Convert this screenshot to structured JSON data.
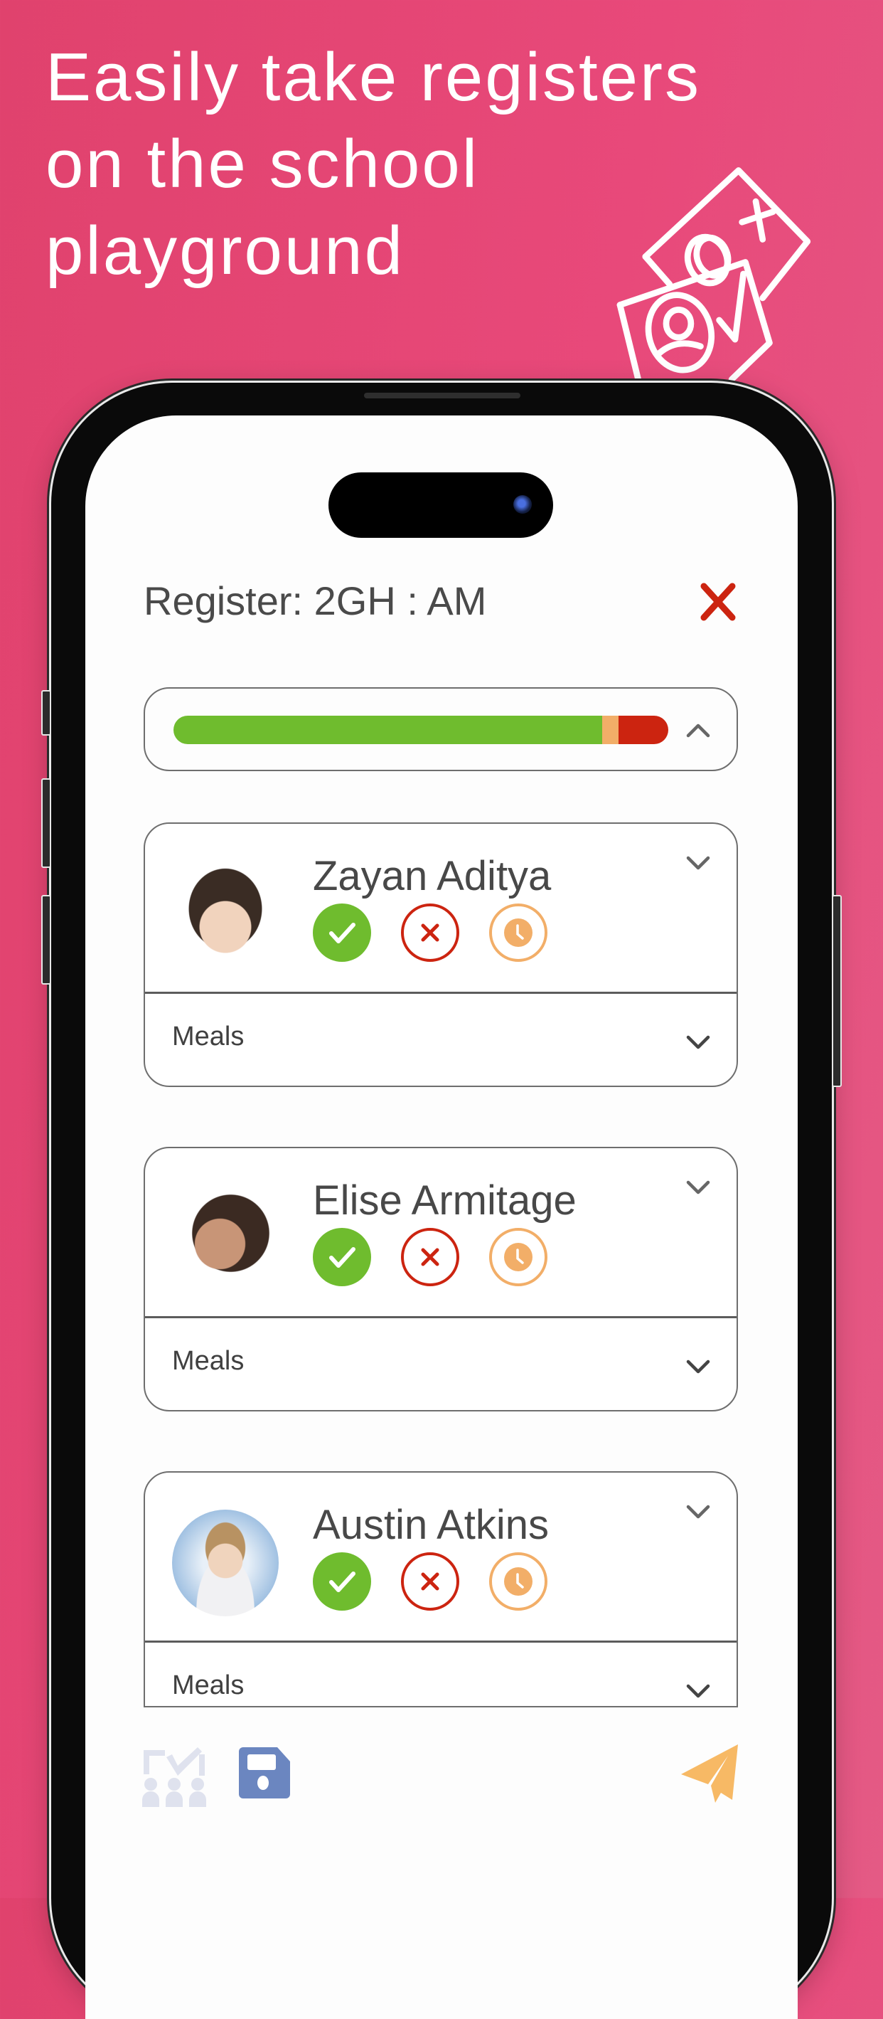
{
  "headline": {
    "lines": [
      "Easily take registers",
      "on the school",
      "playground"
    ]
  },
  "decoration": {
    "icon": "register-cards-icon"
  },
  "app": {
    "register_title": "Register: 2GH : AM",
    "close_icon": "close-icon",
    "colors": {
      "present": "#6fbc2e",
      "late": "#f2ae68",
      "absent": "#cc2410",
      "text": "#4a4a4a",
      "save": "#6b86c0",
      "send": "#f7b965",
      "disabled": "#dfe2ee",
      "background": "#e8497a"
    },
    "attendance_summary": {
      "present_fraction": 0.867,
      "late_fraction": 0.033,
      "absent_fraction": 0.1,
      "collapse_icon": "chevron-up-icon"
    },
    "students": [
      {
        "name": "Zayan Aditya",
        "avatar": "student-photo",
        "statuses": [
          "present",
          "absent",
          "late"
        ],
        "meals_label": "Meals"
      },
      {
        "name": "Elise Armitage",
        "avatar": "student-photo",
        "statuses": [
          "present",
          "absent",
          "late"
        ],
        "meals_label": "Meals"
      },
      {
        "name": "Austin Atkins",
        "avatar": "student-photo",
        "statuses": [
          "present",
          "absent",
          "late"
        ],
        "meals_label": "Meals"
      }
    ],
    "toolbar": {
      "mark_all_icon": "mark-all-present-icon",
      "save_icon": "save-icon",
      "send_icon": "send-icon"
    }
  }
}
